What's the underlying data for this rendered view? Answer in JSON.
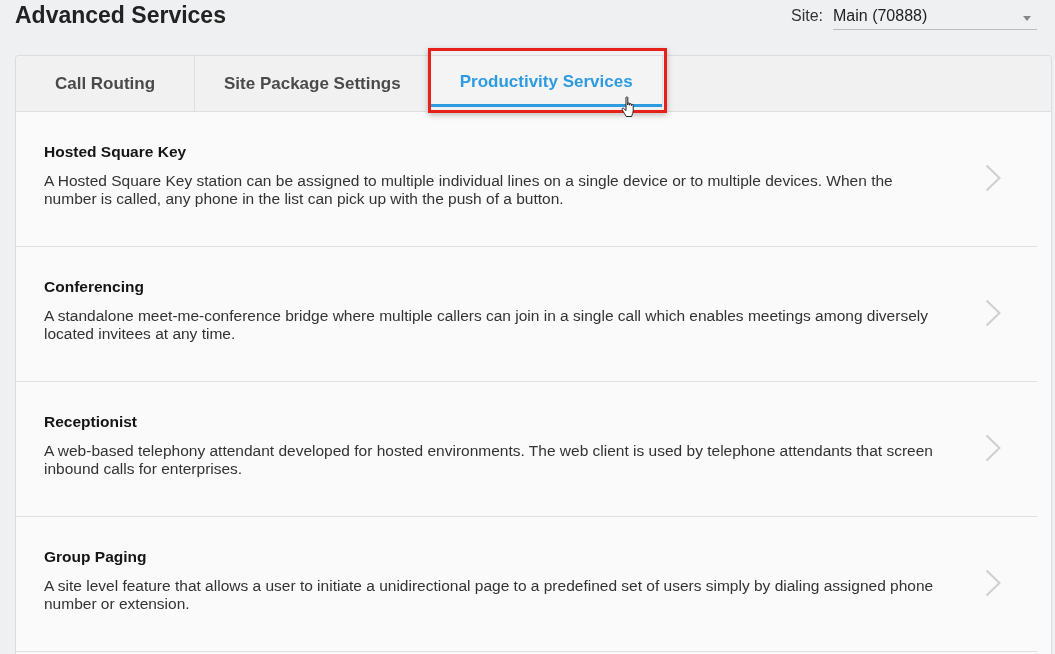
{
  "page": {
    "title": "Advanced Services"
  },
  "site_selector": {
    "label": "Site:",
    "value": "Main (70888)"
  },
  "tabs": [
    {
      "label": "Call Routing",
      "selected": false,
      "highlighted": false,
      "hovered": false
    },
    {
      "label": "Site Package Settings",
      "selected": false,
      "highlighted": false,
      "hovered": false
    },
    {
      "label": "Productivity Services",
      "selected": true,
      "highlighted": true,
      "hovered": true
    }
  ],
  "services": [
    {
      "title": "Hosted Square Key",
      "description": "A Hosted Square Key station can be assigned to multiple individual lines on a single device or to multiple devices. When the number is called, any phone in the list can pick up with the push of a button."
    },
    {
      "title": "Conferencing",
      "description": "A standalone meet-me-conference bridge where multiple callers can join in a single call which enables meetings among diversely located invitees at any time."
    },
    {
      "title": "Receptionist",
      "description": "A web-based telephony attendant developed for hosted environments. The web client is used by telephone attendants that screen inbound calls for enterprises."
    },
    {
      "title": "Group Paging",
      "description": "A site level feature that allows a user to initiate a unidirectional page to a predefined set of users simply by dialing assigned phone number or extension."
    }
  ]
}
